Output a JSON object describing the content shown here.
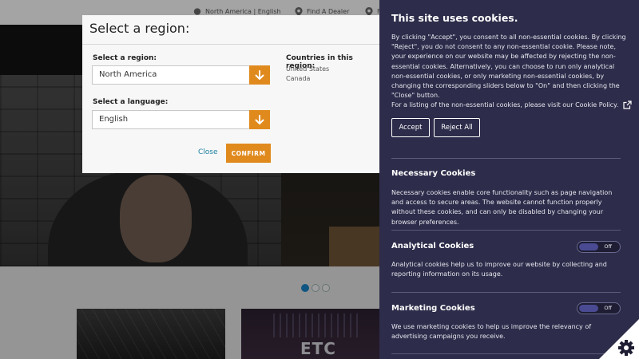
{
  "topbar": {
    "region_text": "North America  |  English",
    "dealer_text": "Find A Dealer",
    "third_text": "F"
  },
  "carousel": {
    "slides": 3,
    "active": 0
  },
  "cards": {
    "etc_logo_text": "ETC"
  },
  "region_modal": {
    "title": "Select a region:",
    "region_label": "Select a region:",
    "region_value": "North America",
    "language_label": "Select a language:",
    "language_value": "English",
    "countries_label": "Countries in this region:",
    "countries": [
      "United States",
      "Canada"
    ],
    "close_label": "Close",
    "confirm_label": "CONFIRM",
    "accent_color": "#e08a1e"
  },
  "cookie_panel": {
    "title": "This site uses cookies.",
    "intro": "By clicking \"Accept\", you consent to all non-essential cookies. By clicking \"Reject\", you do not consent to any non-essential cookie. Please note, your experience on our website may be affected by rejecting the non-essential cookies. Alternatively, you can choose to run only analytical non-essential cookies, or only marketing non-essential cookies, by changing the corresponding sliders below to \"On\" and then clicking the \"Close\" button.",
    "policy_text": "For a listing of the non-essential cookies, please visit our Cookie Policy.",
    "accept_label": "Accept",
    "reject_label": "Reject All",
    "background_color": "#2d2c4a",
    "sections": [
      {
        "title": "Necessary Cookies",
        "text": "Necessary cookies enable core functionality such as page navigation and access to secure areas. The website cannot function properly without these cookies, and can only be disabled by changing your browser preferences."
      },
      {
        "title": "Analytical Cookies",
        "text": "Analytical cookies help us to improve our website by collecting and reporting information on its usage.",
        "toggle_label": "Off"
      },
      {
        "title": "Marketing Cookies",
        "text": "We use marketing cookies to help us improve the relevancy of advertising campaigns you receive.",
        "toggle_label": "Off"
      }
    ]
  }
}
